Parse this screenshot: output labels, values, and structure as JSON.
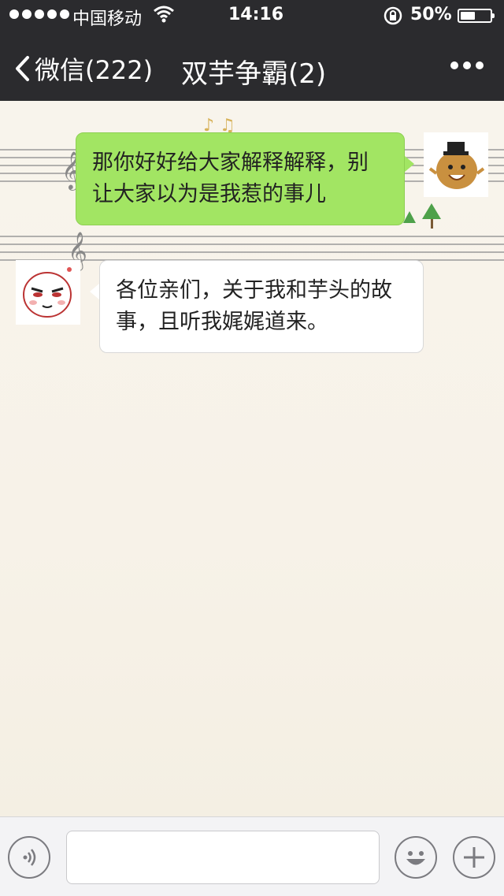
{
  "status_bar": {
    "carrier": "中国移动",
    "time": "14:16",
    "battery": "50%",
    "battery_level": 0.5
  },
  "nav": {
    "back_label": "微信(222)",
    "title": "双芋争霸(2)"
  },
  "messages": [
    {
      "direction": "outgoing",
      "avatar": "potato-with-top-hat",
      "text": "那你好好给大家解释解释，别让大家以为是我惹的事儿"
    },
    {
      "direction": "incoming",
      "avatar": "smirking-face",
      "text": "各位亲们，关于我和芋头的故事，且听我娓娓道来。"
    }
  ],
  "input": {
    "placeholder": ""
  },
  "colors": {
    "nav_bg": "#2b2b2e",
    "outgoing_bubble": "#a2e563",
    "incoming_bubble": "#ffffff",
    "chat_bg": "#f6f1e7"
  }
}
